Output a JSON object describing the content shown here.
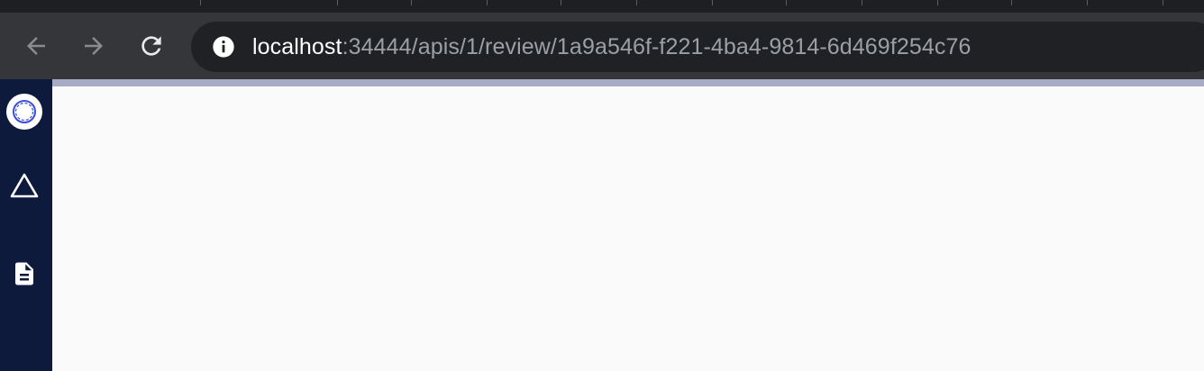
{
  "browser": {
    "address_bar": {
      "host": "localhost",
      "path": ":34444/apis/1/review/1a9a546f-f221-4ba4-9814-6d469f254c76"
    },
    "icons": {
      "back": "arrow-left-icon",
      "forward": "arrow-right-icon",
      "reload": "reload-icon",
      "site_info": "info-icon"
    },
    "colors": {
      "toolbar": "#35363a",
      "omnibox": "#202124",
      "host_text": "#ffffff",
      "path_text": "#9aa0a6",
      "loading_bar": "#a7abc6"
    }
  },
  "app": {
    "sidebar": {
      "background": "#0d1a3b",
      "items": [
        {
          "icon": "logo-ring-icon"
        },
        {
          "icon": "triangle-icon"
        },
        {
          "icon": "document-icon"
        }
      ]
    },
    "main": {
      "background": "#fafafa"
    }
  }
}
